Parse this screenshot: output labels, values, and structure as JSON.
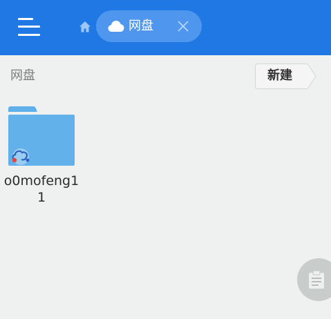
{
  "header": {
    "tab_label": "网盘",
    "icons": {
      "menu": "menu-icon",
      "home": "home-icon",
      "tab": "cloud-icon",
      "close": "close-icon"
    }
  },
  "toolbar": {
    "breadcrumb": "网盘",
    "new_button_label": "新建"
  },
  "files": [
    {
      "name": "o0mofeng11",
      "type": "folder",
      "badge_icon": "cloud-sync-badge-icon"
    }
  ],
  "fab": {
    "icon": "clipboard-icon"
  },
  "colors": {
    "header_bg": "#1f78e4",
    "tab_bg": "#4f96ee",
    "page_bg": "#eef1f0",
    "folder": "#5fb0ea"
  }
}
